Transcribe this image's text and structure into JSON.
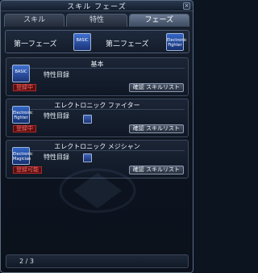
{
  "window": {
    "title": "スキル フェーズ",
    "close_glyph": "×"
  },
  "tabs": [
    {
      "label": "スキル",
      "active": false
    },
    {
      "label": "特性",
      "active": false
    },
    {
      "label": "フェーズ",
      "active": true
    }
  ],
  "phases": {
    "first_label": "第一フェーズ",
    "first_icon_text": "BASIC",
    "second_label": "第二フェーズ",
    "second_icon_text": "Electronic Fighter"
  },
  "cards": [
    {
      "title": "基本",
      "catalog_label": "特性目録",
      "badge": "登録中",
      "icon_text": "BASIC",
      "button": "確認 スキルリスト",
      "has_skill_icon": false
    },
    {
      "title": "エレクトロニック ファイター",
      "catalog_label": "特性目録",
      "badge": "登録中",
      "icon_text": "Electronic Fighter",
      "button": "確認 スキルリスト",
      "has_skill_icon": true
    },
    {
      "title": "エレクトロニック メジシャン",
      "catalog_label": "特性目録",
      "badge": "登録可能",
      "icon_text": "Electronic Magician",
      "button": "確認 スキルリスト",
      "has_skill_icon": true
    }
  ],
  "pager": {
    "text": "2 / 3"
  },
  "colors": {
    "active_tab": "#6a7a92",
    "badge_red": "#ff6c6c",
    "icon_blue": "#1c3374"
  }
}
